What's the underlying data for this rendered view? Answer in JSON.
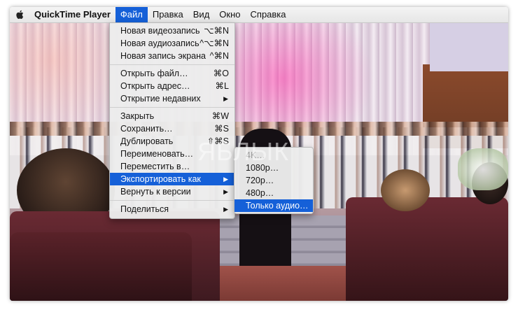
{
  "menubar": {
    "app_name": "QuickTime Player",
    "items": [
      "Файл",
      "Правка",
      "Вид",
      "Окно",
      "Справка"
    ]
  },
  "file_menu": {
    "group1": [
      {
        "label": "Новая видеозапись",
        "shortcut": "⌥⌘N"
      },
      {
        "label": "Новая аудиозапись",
        "shortcut": "^⌥⌘N"
      },
      {
        "label": "Новая запись экрана",
        "shortcut": "^⌘N"
      }
    ],
    "group2": [
      {
        "label": "Открыть файл…",
        "shortcut": "⌘O"
      },
      {
        "label": "Открыть адрес…",
        "shortcut": "⌘L"
      },
      {
        "label": "Открытие недавних",
        "shortcut": "▶"
      }
    ],
    "group3": [
      {
        "label": "Закрыть",
        "shortcut": "⌘W"
      },
      {
        "label": "Сохранить…",
        "shortcut": "⌘S"
      },
      {
        "label": "Дублировать",
        "shortcut": "⇧⌘S"
      },
      {
        "label": "Переименовать…",
        "shortcut": ""
      },
      {
        "label": "Переместить в…",
        "shortcut": ""
      },
      {
        "label": "Экспортировать как",
        "shortcut": "▶"
      },
      {
        "label": "Вернуть к версии",
        "shortcut": "▶"
      }
    ],
    "group4": [
      {
        "label": "Поделиться",
        "shortcut": "▶"
      }
    ]
  },
  "export_submenu": {
    "items": [
      "4K…",
      "1080p…",
      "720p…",
      "480p…",
      "Только аудио…"
    ]
  },
  "watermark": "ЯБЛЫК",
  "colors": {
    "accent": "#1560d8",
    "menu_bg": "#ececec"
  }
}
